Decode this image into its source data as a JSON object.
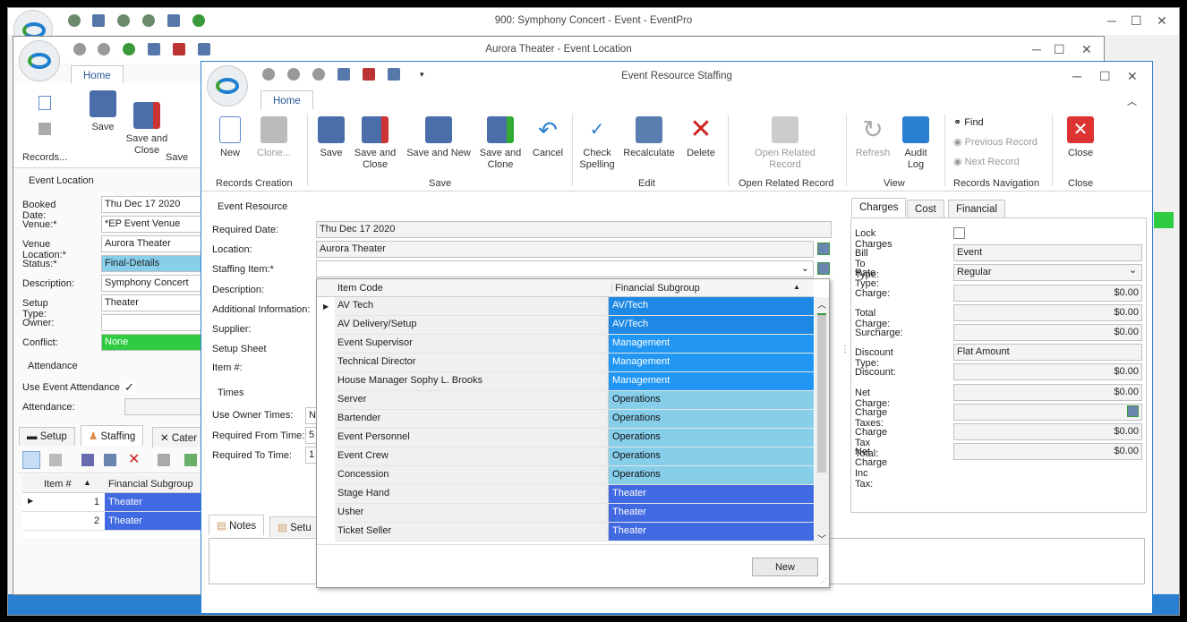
{
  "main_window": {
    "title": "900: Symphony Concert - Event - EventPro"
  },
  "location_window": {
    "title": "Aurora Theater - Event Location",
    "home_tab": "Home",
    "ribbon": {
      "save": "Save",
      "save_close": "Save and\nClose",
      "records": "Records...",
      "save_group": "Save"
    },
    "section": "Event Location",
    "fields": [
      {
        "label": "Booked Date:",
        "value": "Thu Dec 17 2020"
      },
      {
        "label": "Venue:*",
        "value": "*EP Event Venue"
      },
      {
        "label": "Venue Location:*",
        "value": "Aurora Theater"
      },
      {
        "label": "Status:*",
        "value": "Final-Details"
      },
      {
        "label": "Description:",
        "value": "Symphony Concert"
      },
      {
        "label": "Setup Type:",
        "value": "Theater"
      },
      {
        "label": "Owner:",
        "value": ""
      },
      {
        "label": "Conflict:",
        "value": "None"
      }
    ],
    "attendance": {
      "title": "Attendance",
      "use": "Use Event Attendance",
      "attendance": "Attendance:"
    },
    "tabs": [
      "Setup",
      "Staffing",
      "Cater"
    ],
    "grid": {
      "headers": [
        "Item #",
        "Financial Subgroup"
      ],
      "rows": [
        {
          "n": "1",
          "fs": "Theater"
        },
        {
          "n": "2",
          "fs": "Theater"
        }
      ]
    }
  },
  "staffing_window": {
    "title": "Event Resource Staffing",
    "home_tab": "Home",
    "ribbon": {
      "new": "New",
      "clone": "Clone...",
      "records_creation": "Records Creation",
      "save": "Save",
      "save_close": "Save and\nClose",
      "save_new": "Save and New",
      "save_clone": "Save and\nClone",
      "cancel": "Cancel",
      "save_group": "Save",
      "check_spelling": "Check\nSpelling",
      "recalculate": "Recalculate",
      "delete": "Delete",
      "edit_group": "Edit",
      "open_related": "Open Related\nRecord",
      "open_related_group": "Open Related Record",
      "refresh": "Refresh",
      "audit_log": "Audit\nLog",
      "view_group": "View",
      "find": "Find",
      "previous_record": "Previous Record",
      "next_record": "Next Record",
      "nav_group": "Records Navigation",
      "close": "Close",
      "close_group": "Close"
    },
    "event_resource": {
      "title": "Event Resource",
      "required_date_label": "Required Date:",
      "required_date": "Thu Dec 17 2020",
      "location_label": "Location:",
      "location": "Aurora Theater",
      "staffing_item_label": "Staffing Item:*",
      "description_label": "Description:",
      "additional_label": "Additional Information:",
      "supplier_label": "Supplier:",
      "setup_sheet_label": "Setup Sheet",
      "item_no_label": "Item #:"
    },
    "times": {
      "title": "Times",
      "use_owner": "Use Owner Times:",
      "use_owner_val": "N",
      "req_from": "Required From Time:",
      "req_from_val": "5",
      "req_to": "Required To Time:",
      "req_to_val": "1"
    },
    "bottom_tabs": [
      "Notes",
      "Setu"
    ],
    "dropdown": {
      "headers": [
        "Item Code",
        "Financial Subgroup"
      ],
      "rows": [
        {
          "code": "AV Tech",
          "fs": "AV/Tech",
          "color": "#1e88e5"
        },
        {
          "code": "AV Delivery/Setup",
          "fs": "AV/Tech",
          "color": "#1e88e5"
        },
        {
          "code": "Event Supervisor",
          "fs": "Management",
          "color": "#2196f3"
        },
        {
          "code": "Technical Director",
          "fs": "Management",
          "color": "#2196f3"
        },
        {
          "code": "House Manager Sophy L. Brooks",
          "fs": "Management",
          "color": "#2196f3"
        },
        {
          "code": "Server",
          "fs": "Operations",
          "color": "#87ceeb"
        },
        {
          "code": "Bartender",
          "fs": "Operations",
          "color": "#87ceeb"
        },
        {
          "code": "Event Personnel",
          "fs": "Operations",
          "color": "#87ceeb"
        },
        {
          "code": "Event Crew",
          "fs": "Operations",
          "color": "#87ceeb"
        },
        {
          "code": "Concession",
          "fs": "Operations",
          "color": "#87ceeb"
        },
        {
          "code": "Stage Hand",
          "fs": "Theater",
          "color": "#4169e1"
        },
        {
          "code": "Usher",
          "fs": "Theater",
          "color": "#4169e1"
        },
        {
          "code": "Ticket Seller",
          "fs": "Theater",
          "color": "#4169e1"
        }
      ],
      "new_button": "New"
    },
    "charges_tabs": [
      "Charges",
      "Cost",
      "Financial"
    ],
    "charges": {
      "lock": "Lock Charges",
      "bill_to_type_label": "Bill To Type:",
      "bill_to_type": "Event",
      "rate_type_label": "Rate Type:",
      "rate_type": "Regular",
      "charge_label": "Charge:",
      "charge": "$0.00",
      "total_charge_label": "Total Charge:",
      "total_charge": "$0.00",
      "surcharge_label": "Surcharge:",
      "surcharge": "$0.00",
      "discount_type_label": "Discount Type:",
      "discount_type": "Flat Amount",
      "discount_label": "Discount:",
      "discount": "$0.00",
      "net_charge_label": "Net Charge:",
      "net_charge": "$0.00",
      "charge_taxes_label": "Charge Taxes:",
      "charge_tax_total_label": "Charge Tax Total:",
      "charge_tax_total": "$0.00",
      "net_charge_inc_tax_label": "Net Charge Inc Tax:",
      "net_charge_inc_tax": "$0.00"
    }
  },
  "colors": {
    "accent": "#2b579a",
    "status_blue": "#87ceeb",
    "conflict_green": "#2ecc40",
    "theater": "#4169e1"
  }
}
